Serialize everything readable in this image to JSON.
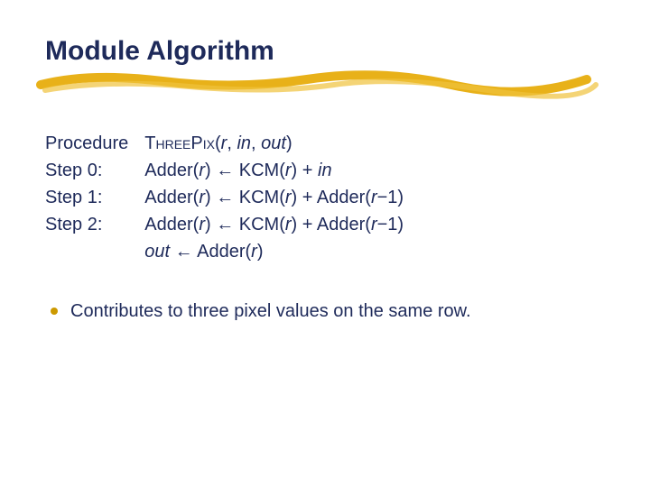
{
  "title": "Module Algorithm",
  "procedure": {
    "label": "Procedure",
    "name_sc": "ThreePix",
    "args_open": "(",
    "arg_r": "r",
    "sep1": ", ",
    "arg_in": "in",
    "sep2": ", ",
    "arg_out": "out",
    "args_close": ")"
  },
  "steps": [
    {
      "label": "Step 0:",
      "lhs_pre": "Adder(",
      "lhs_var": "r",
      "lhs_post": ") ",
      "arrow": "←",
      "rhs_pre": " KCM(",
      "rhs_var": "r",
      "rhs_post": ") + ",
      "tail_ital": "in",
      "tail_plain": ""
    },
    {
      "label": "Step 1:",
      "lhs_pre": "Adder(",
      "lhs_var": "r",
      "lhs_post": ") ",
      "arrow": "←",
      "rhs_pre": " KCM(",
      "rhs_var": "r",
      "rhs_post": ") + Adder(",
      "tail_ital": "r",
      "tail_plain": "−1)"
    },
    {
      "label": "Step 2:",
      "lhs_pre": "Adder(",
      "lhs_var": "r",
      "lhs_post": ") ",
      "arrow": "←",
      "rhs_pre": " KCM(",
      "rhs_var": "r",
      "rhs_post": ") + Adder(",
      "tail_ital": "r",
      "tail_plain": "−1)"
    }
  ],
  "final": {
    "out": "out",
    "arrow": " ← ",
    "adder_pre": "Adder(",
    "adder_var": "r",
    "adder_post": ")"
  },
  "bullet": "Contributes to three pixel values on the same row."
}
